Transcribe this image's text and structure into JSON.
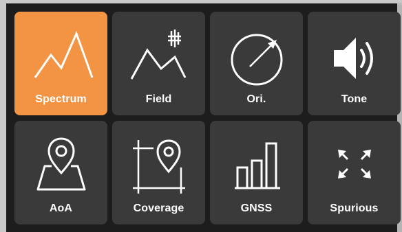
{
  "tiles": [
    {
      "label": "Spectrum",
      "icon": "spectrum-icon",
      "selected": true
    },
    {
      "label": "Field",
      "icon": "field-strength-icon",
      "selected": false
    },
    {
      "label": "Ori.",
      "icon": "compass-icon",
      "selected": false
    },
    {
      "label": "Tone",
      "icon": "speaker-icon",
      "selected": false
    },
    {
      "label": "AoA",
      "icon": "map-pin-icon",
      "selected": false
    },
    {
      "label": "Coverage",
      "icon": "coverage-icon",
      "selected": false
    },
    {
      "label": "GNSS",
      "icon": "bar-chart-icon",
      "selected": false
    },
    {
      "label": "Spurious",
      "icon": "expand-arrows-icon",
      "selected": false
    }
  ],
  "colors": {
    "selected": "#f39444",
    "tile": "#3a3a3a",
    "background": "#1d1d1d",
    "text": "#ffffff"
  }
}
